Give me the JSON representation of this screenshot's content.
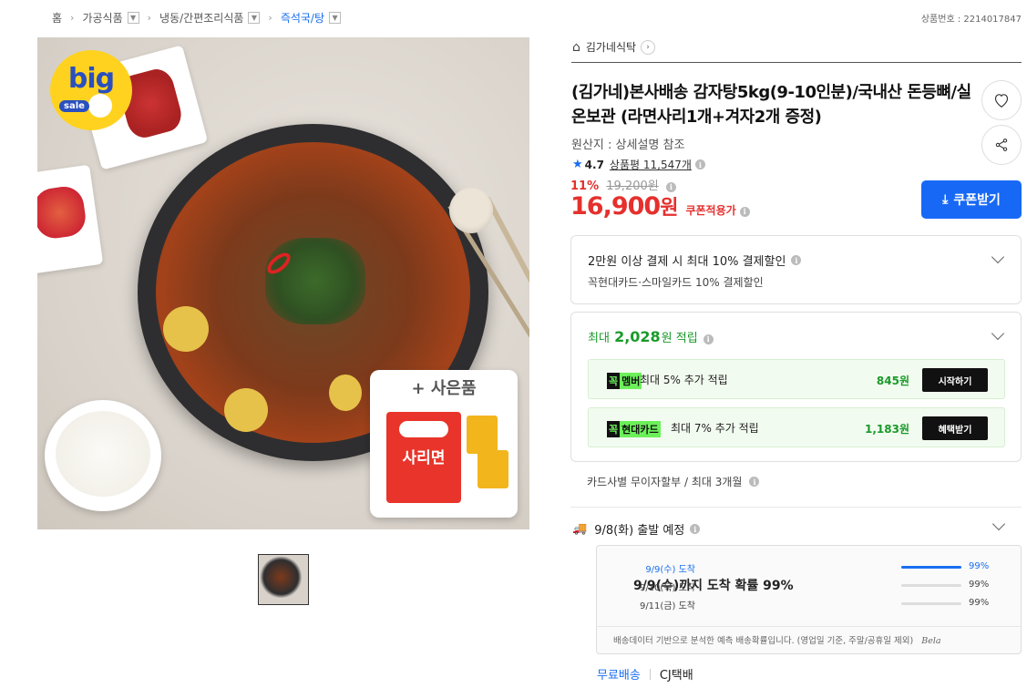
{
  "breadcrumb": [
    {
      "label": "홈",
      "dropdown": false
    },
    {
      "label": "가공식품",
      "dropdown": true
    },
    {
      "label": "냉동/간편조리식품",
      "dropdown": true
    },
    {
      "label": "즉석국/탕",
      "dropdown": true,
      "active": true
    }
  ],
  "product_number": "상품번호 : 2214017847",
  "image": {
    "badge_big": "big",
    "badge_sale": "sale",
    "gift_label": "+ 사은품",
    "ramen_label": "사리면"
  },
  "seller": {
    "name": "김가네식탁"
  },
  "product": {
    "title": "(김가네)본사배송 감자탕5kg(9-10인분)/국내산 돈등뼈/실온보관 (라면사리1개+겨자2개 증정)",
    "origin": "원산지 : 상세설명 참조",
    "rating": "4.7",
    "review_count": "상품평 11,547개",
    "discount_pct": "11%",
    "original_price": "19,200원",
    "price_num": "16,900",
    "price_unit": "원",
    "coupon_note": "쿠폰적용가",
    "coupon_button": "쿠폰받기"
  },
  "card_discount": {
    "title": "2만원 이상 결제 시 최대 10% 결제할인",
    "subtitle": "꼭현대카드·스마일카드 10% 결제할인"
  },
  "points": {
    "prefix": "최대",
    "amount": "2,028",
    "suffix": "원 적립",
    "rows": [
      {
        "tag1": "꼭",
        "tag2": "멤버",
        "desc": "최대 5% 추가 적립",
        "amount": "845원",
        "button": "시작하기"
      },
      {
        "tag1": "꼭",
        "tag2": "현대카드",
        "desc": "최대 7% 추가 적립",
        "amount": "1,183원",
        "button": "혜택받기"
      }
    ]
  },
  "installment": "카드사별 무이자할부 / 최대 3개월",
  "shipping": {
    "departure": "9/8(화) 출발 예정",
    "arrival_summary": "9/9(수)까지 도착 확률 99%",
    "estimates": [
      {
        "label": "9/9(수) 도착",
        "percent": "99%",
        "fill": 1.0
      },
      {
        "label": "9/10(목) 도착",
        "percent": "99%",
        "fill": 0
      },
      {
        "label": "9/11(금) 도착",
        "percent": "99%",
        "fill": 0
      }
    ],
    "note": "배송데이터 기반으로 분석한 예측 배송확률입니다. (영업일 기준, 주말/공휴일 제외)",
    "brand": "Bela",
    "free": "무료배송",
    "carrier": "CJ택배"
  },
  "colors": {
    "accent": "#1769f5",
    "price": "#e5302d",
    "points": "#1a9a2a"
  },
  "icons": [
    "home-icon",
    "heart-icon",
    "share-icon",
    "star-icon",
    "info-icon",
    "truck-icon",
    "chevron-down-icon"
  ]
}
